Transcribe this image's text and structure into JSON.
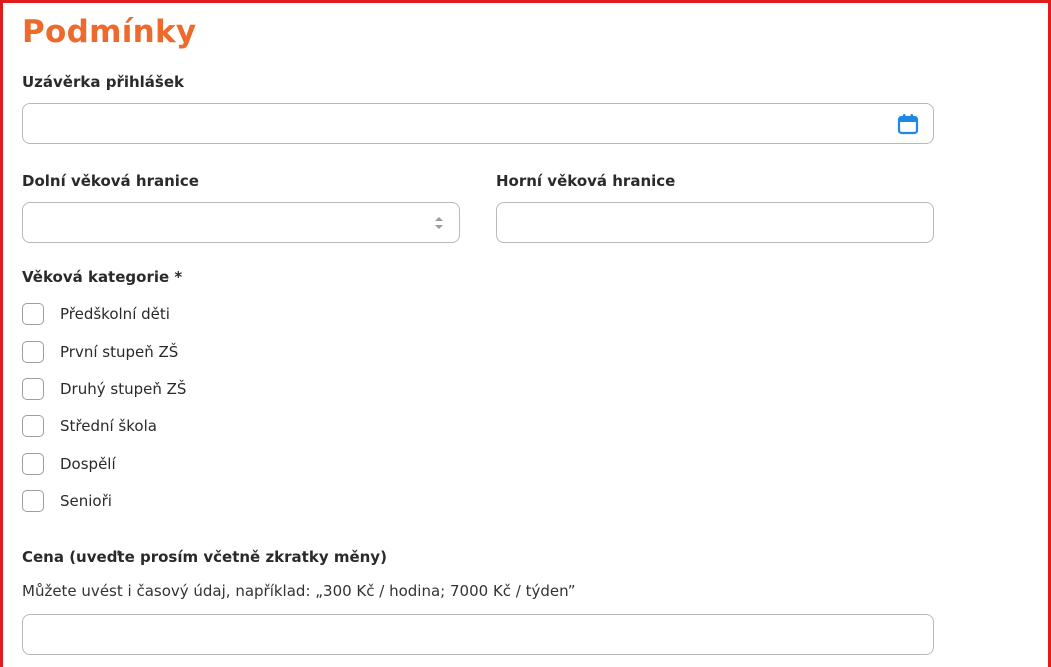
{
  "section": {
    "title": "Podmínky"
  },
  "deadline": {
    "label": "Uzávěrka přihlášek",
    "value": "",
    "icon": "calendar-icon"
  },
  "age_min": {
    "label": "Dolní věková hranice",
    "value": ""
  },
  "age_max": {
    "label": "Horní věková hranice",
    "value": ""
  },
  "age_category": {
    "label": "Věková kategorie *",
    "options": [
      {
        "label": "Předškolní děti",
        "checked": false
      },
      {
        "label": "První stupeň ZŠ",
        "checked": false
      },
      {
        "label": "Druhý stupeň ZŠ",
        "checked": false
      },
      {
        "label": "Střední škola",
        "checked": false
      },
      {
        "label": "Dospělí",
        "checked": false
      },
      {
        "label": "Senioři",
        "checked": false
      }
    ]
  },
  "price": {
    "label": "Cena (uveďte prosím včetně zkratky měny)",
    "hint": "Můžete uvést i časový údaj, například: „300 Kč / hodina; 7000 Kč / týden”",
    "value": ""
  },
  "colors": {
    "accent": "#ee6a2c",
    "frame": "#e01b1b",
    "icon": "#1e88e5"
  }
}
